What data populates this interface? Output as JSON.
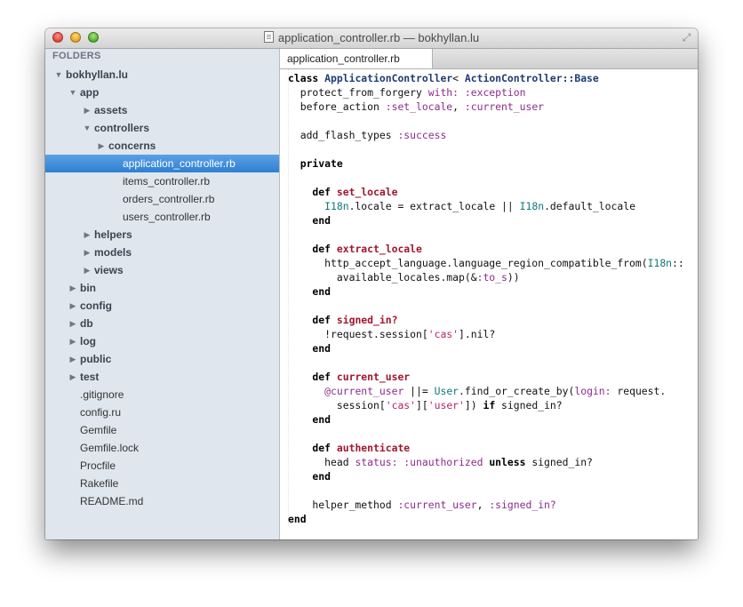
{
  "window": {
    "title": "application_controller.rb — bokhyllan.lu"
  },
  "sidebar": {
    "header": "FOLDERS",
    "items": [
      {
        "label": "bokhyllan.lu",
        "arrow": "▼",
        "bold": true
      },
      {
        "label": "app",
        "arrow": "▼",
        "bold": true
      },
      {
        "label": "assets",
        "arrow": "▶",
        "bold": true
      },
      {
        "label": "controllers",
        "arrow": "▼",
        "bold": true
      },
      {
        "label": "concerns",
        "arrow": "▶",
        "bold": true
      },
      {
        "label": "application_controller.rb",
        "arrow": "",
        "bold": false,
        "selected": true
      },
      {
        "label": "items_controller.rb",
        "arrow": "",
        "bold": false
      },
      {
        "label": "orders_controller.rb",
        "arrow": "",
        "bold": false
      },
      {
        "label": "users_controller.rb",
        "arrow": "",
        "bold": false
      },
      {
        "label": "helpers",
        "arrow": "▶",
        "bold": true
      },
      {
        "label": "models",
        "arrow": "▶",
        "bold": true
      },
      {
        "label": "views",
        "arrow": "▶",
        "bold": true
      },
      {
        "label": "bin",
        "arrow": "▶",
        "bold": true
      },
      {
        "label": "config",
        "arrow": "▶",
        "bold": true
      },
      {
        "label": "db",
        "arrow": "▶",
        "bold": true
      },
      {
        "label": "log",
        "arrow": "▶",
        "bold": true
      },
      {
        "label": "public",
        "arrow": "▶",
        "bold": true
      },
      {
        "label": "test",
        "arrow": "▶",
        "bold": true
      },
      {
        "label": ".gitignore",
        "arrow": "",
        "bold": false
      },
      {
        "label": "config.ru",
        "arrow": "",
        "bold": false
      },
      {
        "label": "Gemfile",
        "arrow": "",
        "bold": false
      },
      {
        "label": "Gemfile.lock",
        "arrow": "",
        "bold": false
      },
      {
        "label": "Procfile",
        "arrow": "",
        "bold": false
      },
      {
        "label": "Rakefile",
        "arrow": "",
        "bold": false
      },
      {
        "label": "README.md",
        "arrow": "",
        "bold": false
      }
    ]
  },
  "editor": {
    "tab_label": "application_controller.rb",
    "lines": [
      [
        [
          "kw",
          "class "
        ],
        [
          "cname",
          "ApplicationController"
        ],
        [
          "",
          "< "
        ],
        [
          "cname",
          "ActionController::Base"
        ]
      ],
      [
        [
          "",
          "  protect_from_forgery "
        ],
        [
          "sym",
          "with: :exception"
        ]
      ],
      [
        [
          "",
          "  before_action "
        ],
        [
          "sym",
          ":set_locale"
        ],
        [
          "",
          ", "
        ],
        [
          "sym",
          ":current_user"
        ]
      ],
      [],
      [
        [
          "",
          "  add_flash_types "
        ],
        [
          "sym",
          ":success"
        ]
      ],
      [],
      [
        [
          "kw",
          "  private"
        ]
      ],
      [],
      [
        [
          "kw",
          "    def "
        ],
        [
          "fn",
          "set_locale"
        ]
      ],
      [
        [
          "",
          "      "
        ],
        [
          "cls",
          "I18n"
        ],
        [
          "",
          ".locale = extract_locale || "
        ],
        [
          "cls",
          "I18n"
        ],
        [
          "",
          ".default_locale"
        ]
      ],
      [
        [
          "kw",
          "    end"
        ]
      ],
      [],
      [
        [
          "kw",
          "    def "
        ],
        [
          "fn",
          "extract_locale"
        ]
      ],
      [
        [
          "",
          "      http_accept_language.language_region_compatible_from("
        ],
        [
          "cls",
          "I18n"
        ],
        [
          "",
          "::"
        ]
      ],
      [
        [
          "",
          "        available_locales.map(&"
        ],
        [
          "sym",
          ":to_s"
        ],
        [
          "",
          "))"
        ]
      ],
      [
        [
          "kw",
          "    end"
        ]
      ],
      [],
      [
        [
          "kw",
          "    def "
        ],
        [
          "fn",
          "signed_in?"
        ]
      ],
      [
        [
          "",
          "      !request.session["
        ],
        [
          "str",
          "'cas'"
        ],
        [
          "",
          "].nil?"
        ]
      ],
      [
        [
          "kw",
          "    end"
        ]
      ],
      [],
      [
        [
          "kw",
          "    def "
        ],
        [
          "fn",
          "current_user"
        ]
      ],
      [
        [
          "",
          "      "
        ],
        [
          "sym",
          "@current_user"
        ],
        [
          "",
          " ||= "
        ],
        [
          "cls",
          "User"
        ],
        [
          "",
          ".find_or_create_by("
        ],
        [
          "sym",
          "login:"
        ],
        [
          "",
          " request."
        ]
      ],
      [
        [
          "",
          "        session["
        ],
        [
          "str",
          "'cas'"
        ],
        [
          "",
          "]["
        ],
        [
          "str",
          "'user'"
        ],
        [
          "",
          "]) "
        ],
        [
          "kw",
          "if"
        ],
        [
          "",
          " signed_in?"
        ]
      ],
      [
        [
          "kw",
          "    end"
        ]
      ],
      [],
      [
        [
          "kw",
          "    def "
        ],
        [
          "fn",
          "authenticate"
        ]
      ],
      [
        [
          "",
          "      head "
        ],
        [
          "sym",
          "status: :unauthorized"
        ],
        [
          "",
          " "
        ],
        [
          "kw",
          "unless"
        ],
        [
          "",
          " signed_in?"
        ]
      ],
      [
        [
          "kw",
          "    end"
        ]
      ],
      [],
      [
        [
          "",
          "    helper_method "
        ],
        [
          "sym",
          ":current_user"
        ],
        [
          "",
          ", "
        ],
        [
          "sym",
          ":signed_in?"
        ]
      ],
      [
        [
          "kw",
          "end"
        ]
      ]
    ]
  }
}
